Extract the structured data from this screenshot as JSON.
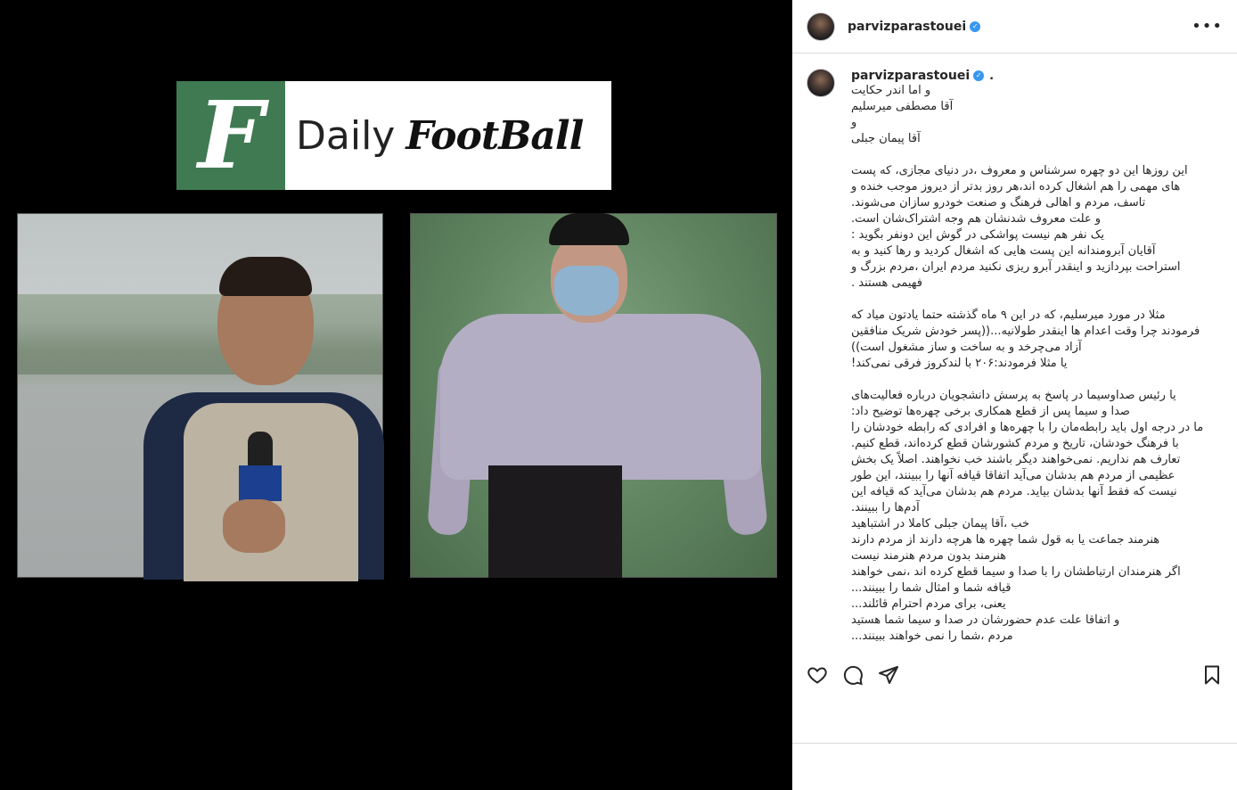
{
  "post": {
    "username": "parvizparastouei",
    "caption_dot": ".",
    "caption_lines": [
      "و اما اندر حکایت",
      "آقا مصطفی میرسلیم",
      "و",
      "آقا پیمان جبلی",
      "",
      "این روزها این دو چهره سرشناس و معروف ،در دنیای مجازی، که پست",
      "های مهمی را هم اشغال کرده اند،هر روز بدتر از دیروز موجب خنده و",
      "تاسف، مردم و اهالی فرهنگ و صنعت خودرو سازان می‌شوند.",
      "و علت معروف شدنشان هم وجه اشتراک‌شان است.",
      "یک نفر هم نیست پواشکی در گوش این دونفر بگوید :",
      "آقایان آبرومندانه این پست هایی که اشغال کردید و رها کنید و به",
      "استراحت بپردازید و اینقدر آبرو ریزی نکنید مردم ایران ،مردم بزرگ و",
      "فهیمی هستند .",
      "",
      "مثلا در مورد میرسلیم، که در این ۹ ماه گذشته حتما یادتون میاد که",
      "فرمودند چرا وقت اعدام ها اینقدر طولانیه...((پسر خودش شریک منافقین",
      "آزاد می‌چرخد و به ساخت و ساز مشغول است))",
      "یا مثلا فرمودند:۲۰۶ با لندکروز فرقی نمی‌کند!",
      "",
      "یا رئیس صداوسیما در پاسخ به پرسش دانشجویان درباره فعالیت‌های",
      "صدا و سیما پس از قطع همکاری برخی چهره‌ها توضیح داد:",
      "ما در درجه اول باید رابطه‌مان را با چهره‌ها و افرادی که رابطه خودشان را",
      "با فرهنگ خودشان، تاریخ و مردم کشورشان قطع کرده‌اند، قطع کنیم.",
      "تعارف هم نداریم. نمی‌خواهند دیگر باشند خب نخواهند. اصلاً یک بخش",
      "عظیمی از مردم هم بدشان می‌آید اتفاقا قیافه آنها را ببینند، این طور",
      "نیست که فقط آنها بدشان بیاید. مردم هم بدشان می‌آید که قیافه این",
      "آدم‌ها را ببینند.",
      "خب ،آقا پیمان جبلی کاملا در اشتباهید",
      "هنرمند جماعت یا به قول شما چهره ها هرچه دارند از مردم دارند",
      "هنرمند بدون مردم هنرمند نیست",
      "اگر هنرمندان ارتباطشان را با صدا و سیما قطع کرده اند ،نمی خواهند",
      "قیافه شما و امثال شما را ببینند...",
      "یعنی، برای مردم احترام قائلند...",
      "و اتفاقا علت عدم حضورشان در صدا و سیما شما هستید",
      "مردم ،شما را نمی خواهند ببینند..."
    ]
  },
  "image": {
    "logo_letter": "F",
    "logo_daily": "Daily",
    "logo_football": "FootBall"
  },
  "icons": {
    "more": "more-icon",
    "like": "heart-icon",
    "comment": "comment-icon",
    "share": "share-icon",
    "save": "bookmark-icon",
    "verified": "verified-badge-icon"
  },
  "colors": {
    "verified": "#3897f0",
    "logo_green": "#3f7a52"
  }
}
